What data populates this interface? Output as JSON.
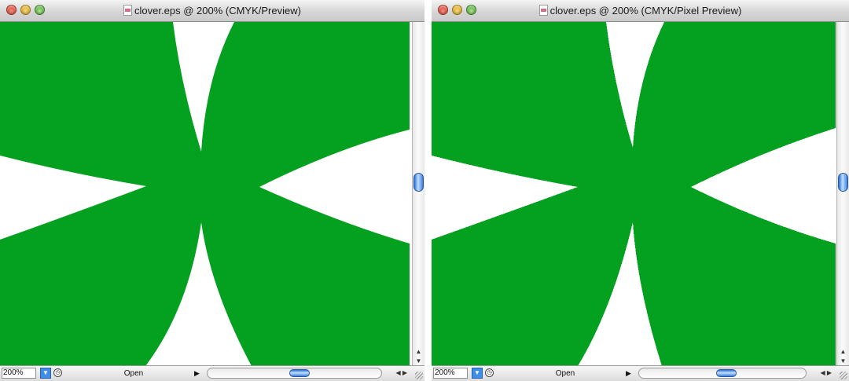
{
  "colors": {
    "shape_fill": "#04a01f",
    "background": "#ffffff"
  },
  "windows": [
    {
      "title": "clover.eps @ 200% (CMYK/Preview)",
      "zoom": "200%",
      "status": "Open",
      "icons": [
        "document-icon",
        "zoom-menu-icon",
        "clock-icon",
        "play-icon"
      ]
    },
    {
      "title": "clover.eps @ 200% (CMYK/Pixel Preview)",
      "zoom": "200%",
      "status": "Open",
      "icons": [
        "document-icon",
        "zoom-menu-icon",
        "clock-icon",
        "play-icon"
      ]
    }
  ]
}
